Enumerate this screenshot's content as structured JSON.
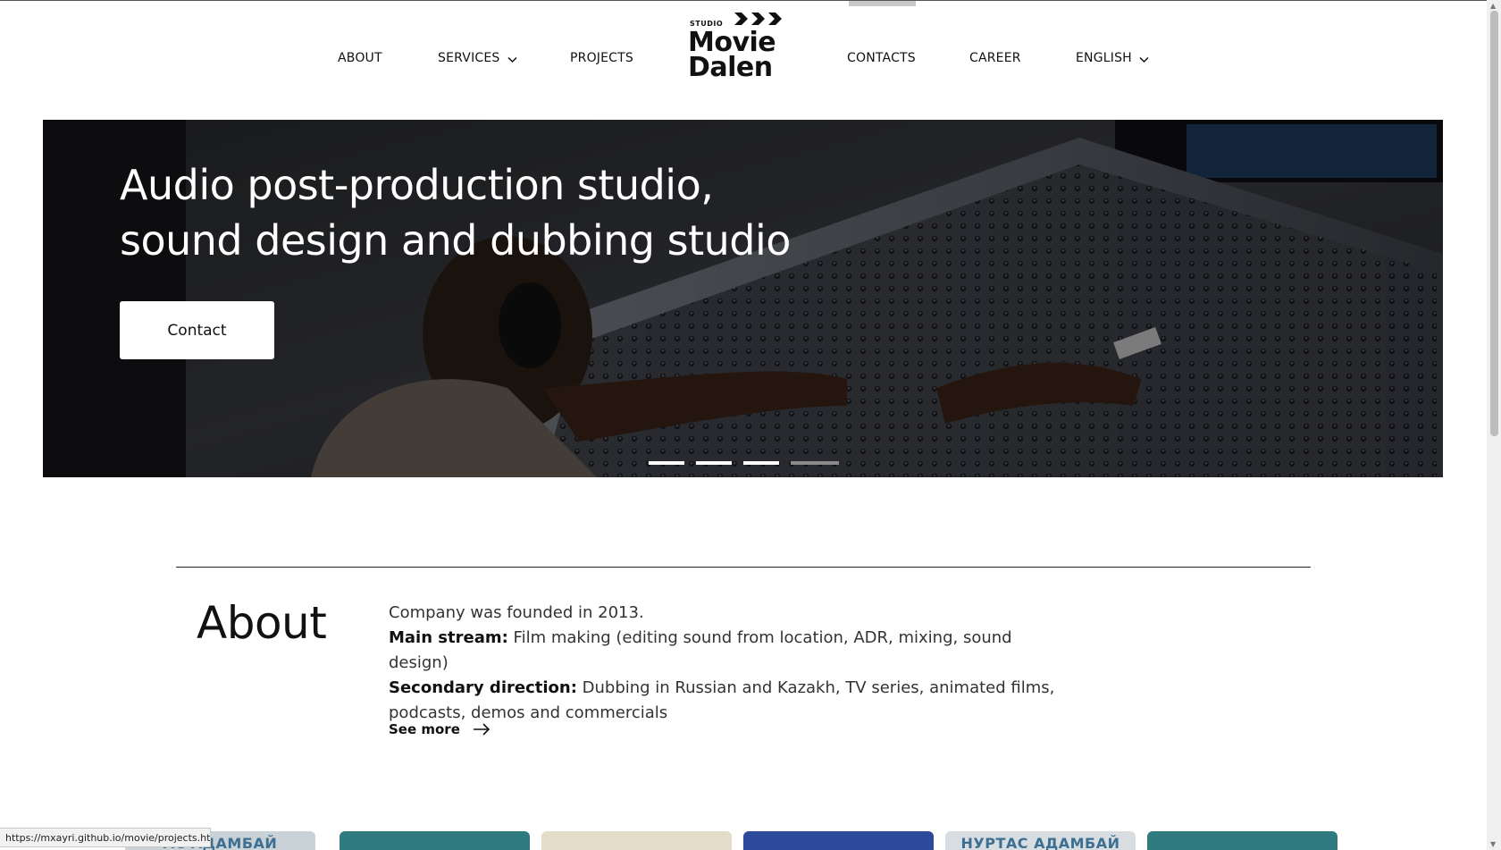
{
  "nav": {
    "about": "ABOUT",
    "services": "SERVICES",
    "projects": "PROJECTS",
    "contacts": "CONTACTS",
    "career": "CAREER",
    "language": "ENGLISH"
  },
  "logo": {
    "small": "STUDIO",
    "line1": "Movie",
    "line2": "Dalen"
  },
  "hero": {
    "title_line1": "Audio post-production studio,",
    "title_line2": "sound design and dubbing studio",
    "button": "Contact",
    "slides_total": 4,
    "active_slides": 3
  },
  "about": {
    "title": "About",
    "founded": "Company was founded in 2013.",
    "main_label": "Main stream:",
    "main_text": " Film making (editing sound from location, ADR, mixing, sound design)",
    "secondary_label": "Secondary direction:",
    "secondary_text": " Dubbing in Russian and Kazakh, TV series, animated films, podcasts, demos and commercials",
    "see_more": "See more"
  },
  "thumbnails": [
    {
      "caption": "АС АДАМБАЙ"
    },
    {
      "caption": ""
    },
    {
      "caption": ""
    },
    {
      "caption": ""
    },
    {
      "caption": "НУРТАС АДАМБАЙ"
    },
    {
      "caption": ""
    }
  ],
  "status_url": "https://mxayri.github.io/movie/projects.htm",
  "colors": {
    "text": "#111111",
    "hero_overlay": "#1a1b1e",
    "button_bg": "#ffffff"
  }
}
